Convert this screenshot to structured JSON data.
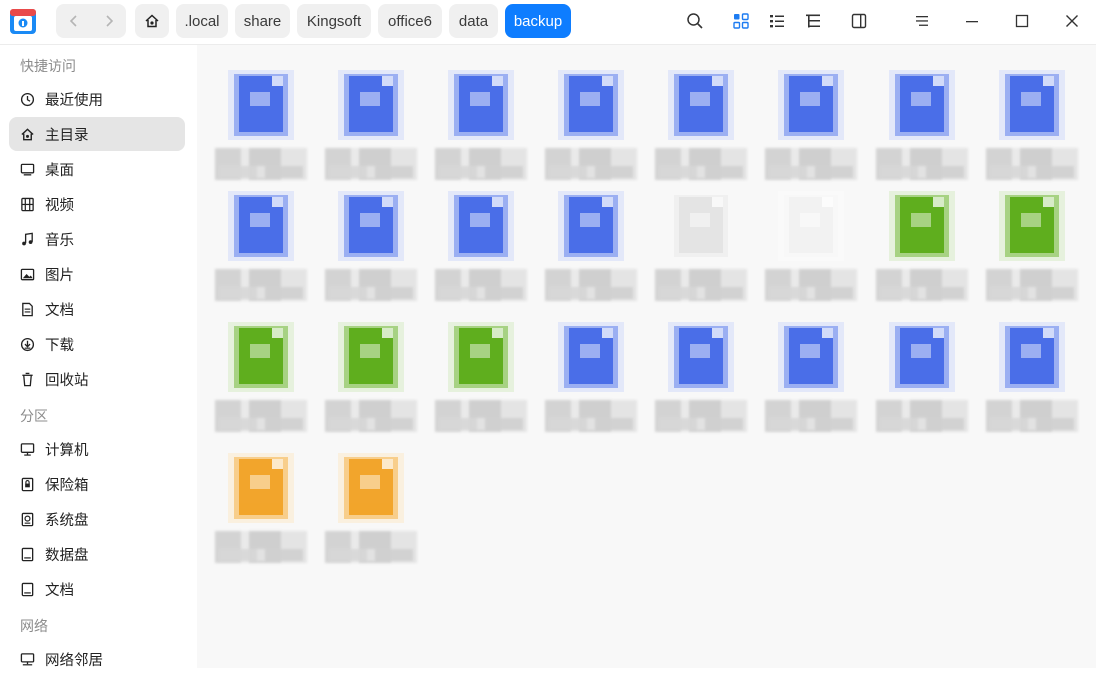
{
  "window": {
    "breadcrumbs": [
      ".local",
      "share",
      "Kingsoft",
      "office6",
      "data",
      "backup"
    ],
    "active_crumb": "backup"
  },
  "toolbar": {
    "icons": [
      "search-icon",
      "icon-view-icon",
      "list-view-icon",
      "tree-view-icon",
      "detail-panel-icon",
      "menu-icon",
      "minimize-icon",
      "maximize-icon",
      "close-icon"
    ]
  },
  "sidebar": {
    "quick_access_label": "快捷访问",
    "quick_access": [
      {
        "label": "最近使用",
        "icon": "clock-icon"
      },
      {
        "label": "主目录",
        "icon": "home-icon",
        "selected": true
      },
      {
        "label": "桌面",
        "icon": "desktop-icon"
      },
      {
        "label": "视频",
        "icon": "video-icon"
      },
      {
        "label": "音乐",
        "icon": "music-icon"
      },
      {
        "label": "图片",
        "icon": "picture-icon"
      },
      {
        "label": "文档",
        "icon": "document-icon"
      },
      {
        "label": "下载",
        "icon": "download-icon"
      },
      {
        "label": "回收站",
        "icon": "trash-icon"
      }
    ],
    "partitions_label": "分区",
    "partitions": [
      {
        "label": "计算机",
        "icon": "computer-icon"
      },
      {
        "label": "保险箱",
        "icon": "safe-icon"
      },
      {
        "label": "系统盘",
        "icon": "disk-icon"
      },
      {
        "label": "数据盘",
        "icon": "drive-icon"
      },
      {
        "label": "文档",
        "icon": "drive-icon"
      }
    ],
    "network_label": "网络",
    "network": [
      {
        "label": "网络邻居",
        "icon": "network-icon"
      }
    ]
  },
  "files": [
    {
      "type": "writer",
      "color": "#4a6ee8"
    },
    {
      "type": "writer",
      "color": "#4a6ee8"
    },
    {
      "type": "writer",
      "color": "#4a6ee8"
    },
    {
      "type": "writer",
      "color": "#4a6ee8"
    },
    {
      "type": "writer",
      "color": "#4a6ee8"
    },
    {
      "type": "writer",
      "color": "#4a6ee8"
    },
    {
      "type": "writer",
      "color": "#4a6ee8"
    },
    {
      "type": "writer",
      "color": "#4a6ee8"
    },
    {
      "type": "writer",
      "color": "#4a6ee8"
    },
    {
      "type": "writer",
      "color": "#4a6ee8"
    },
    {
      "type": "writer",
      "color": "#4a6ee8"
    },
    {
      "type": "writer",
      "color": "#4a6ee8"
    },
    {
      "type": "blank",
      "color": "#e4e4e4"
    },
    {
      "type": "blank",
      "color": "#f2f2f2"
    },
    {
      "type": "sheet",
      "color": "#5fae1e"
    },
    {
      "type": "sheet",
      "color": "#5fae1e"
    },
    {
      "type": "sheet",
      "color": "#5fae1e"
    },
    {
      "type": "sheet",
      "color": "#5fae1e"
    },
    {
      "type": "sheet",
      "color": "#5fae1e"
    },
    {
      "type": "writer",
      "color": "#4a6ee8"
    },
    {
      "type": "writer",
      "color": "#4a6ee8"
    },
    {
      "type": "writer",
      "color": "#4a6ee8"
    },
    {
      "type": "writer",
      "color": "#4a6ee8"
    },
    {
      "type": "writer",
      "color": "#4a6ee8"
    },
    {
      "type": "slides",
      "color": "#f2a52c"
    },
    {
      "type": "slides",
      "color": "#f2a52c"
    }
  ],
  "colors": {
    "accent": "#0e7dff",
    "selected_bg": "#e5e5e5"
  }
}
